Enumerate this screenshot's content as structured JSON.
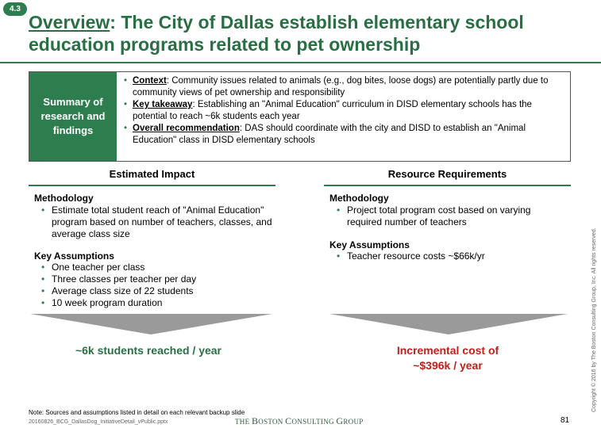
{
  "badge": "4.3",
  "title": {
    "lead": "Overview",
    "rest": ": The City of Dallas establish elementary school education programs related to pet ownership"
  },
  "summary": {
    "label": "Summary of research and findings",
    "items": [
      {
        "key": "Context",
        "sep": ":",
        "text": "  Community issues related to animals (e.g., dog bites, loose dogs) are potentially partly due to community views of pet ownership and responsibility"
      },
      {
        "key": "Key takeaway",
        "sep": ":",
        "text": "   Establishing an \"Animal Education\" curriculum in DISD elementary schools has the potential to reach ~6k students each year"
      },
      {
        "key": "Overall recommendation",
        "sep": ":",
        "text": "   DAS should coordinate with the city and DISD to establish an \"Animal Education\" class in DISD elementary schools"
      }
    ]
  },
  "impact": {
    "heading": "Estimated Impact",
    "methodology_label": "Methodology",
    "methodology": [
      " Estimate total student reach of \"Animal Education\" program based on number of teachers, classes, and average class size"
    ],
    "assumptions_label": "Key Assumptions",
    "assumptions": [
      "One teacher per class",
      "Three classes per teacher per day",
      "Average class size of 22 students",
      "10 week program duration"
    ],
    "result": "~6k students reached / year"
  },
  "resources": {
    "heading": "Resource Requirements",
    "methodology_label": "Methodology",
    "methodology": [
      "Project total program cost based on varying required number of teachers"
    ],
    "assumptions_label": "Key Assumptions",
    "assumptions": [
      "Teacher resource costs ~$66k/yr"
    ],
    "result_line1": "Incremental cost of",
    "result_line2": "~$396k / year"
  },
  "footer": {
    "note": "Note: Sources and assumptions listed in detail on each relevant backup slide",
    "file": "20160826_BCG_DallasDog_InitiativeDetail_vPublic.pptx",
    "logo_the": "THE ",
    "logo_b": "B",
    "logo_oston": "OSTON ",
    "logo_c": "C",
    "logo_onsulting": "ONSULTING ",
    "logo_g": "G",
    "logo_roup": "ROUP",
    "page": "81",
    "copyright": "Copyright © 2016 by The Boston Consulting Group, Inc. All rights reserved."
  },
  "colors": {
    "accent": "#2e7d4f",
    "result_green": "#2a6e44",
    "result_red": "#c0211a",
    "arrow": "#9a9a9a"
  }
}
